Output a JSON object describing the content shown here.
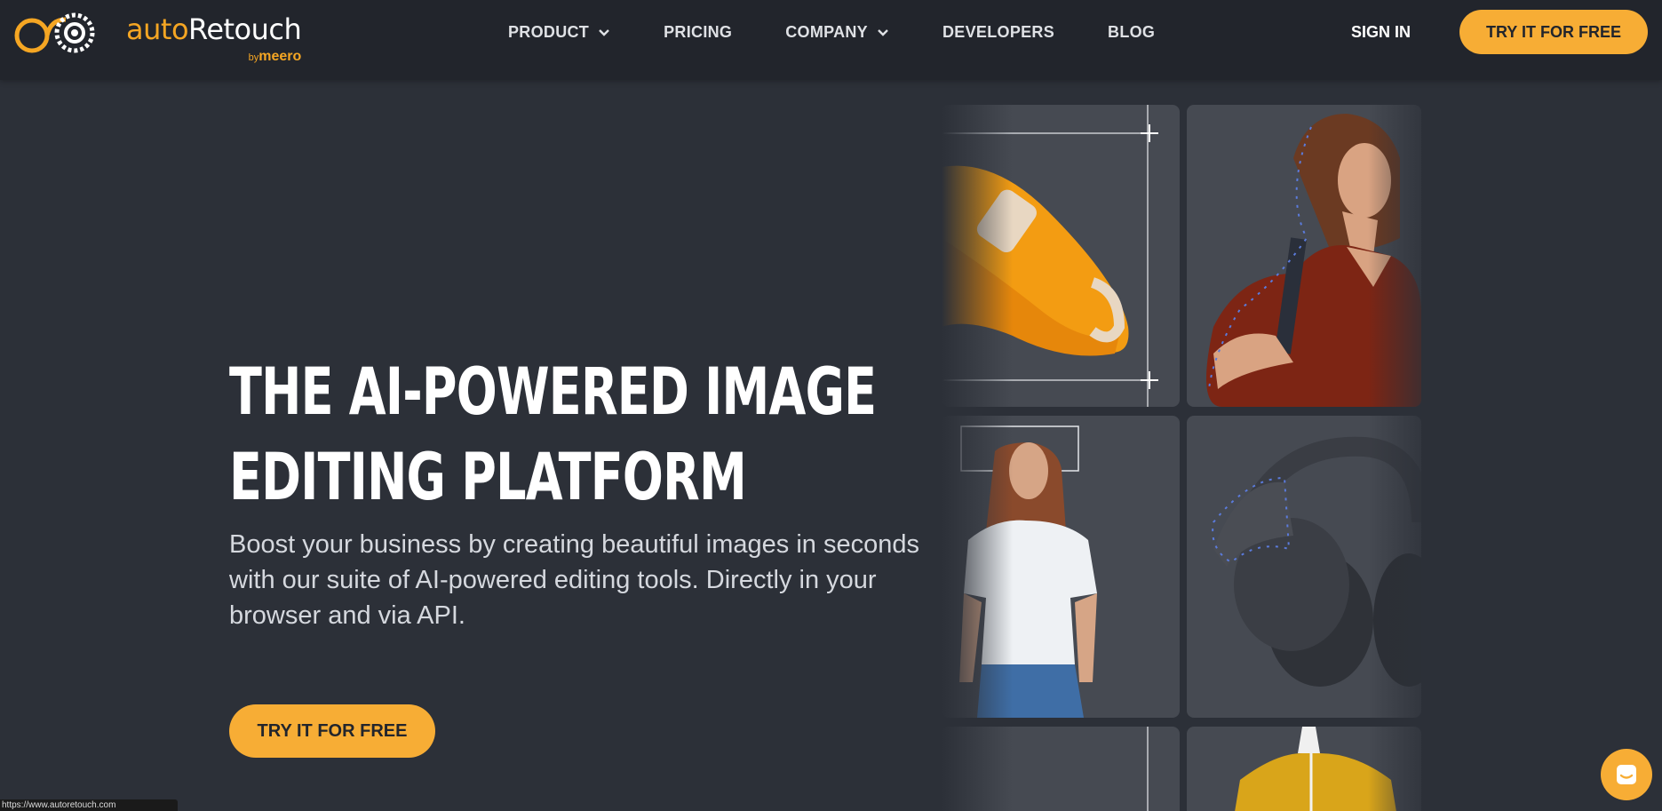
{
  "brand": {
    "name_part1": "auto",
    "name_part2": "Retouch",
    "by": "by",
    "parent": "meero",
    "accent": "#f5a623"
  },
  "nav": {
    "items": [
      {
        "label": "PRODUCT",
        "has_dropdown": true
      },
      {
        "label": "PRICING",
        "has_dropdown": false
      },
      {
        "label": "COMPANY",
        "has_dropdown": true
      },
      {
        "label": "DEVELOPERS",
        "has_dropdown": false
      },
      {
        "label": "BLOG",
        "has_dropdown": false
      }
    ],
    "sign_in": "SIGN IN",
    "cta": "TRY IT FOR FREE"
  },
  "hero": {
    "title_line1": "THE AI-POWERED IMAGE",
    "title_line2": "EDITING PLATFORM",
    "subtitle": "Boost your business by creating beautiful images in seconds with our suite of AI-powered editing tools. Directly in your browser and via API.",
    "cta": "TRY IT FOR FREE"
  },
  "gallery": {
    "tiles": [
      "sneaker-image",
      "woman-red-blouse-image",
      "woman-white-tshirt-image",
      "headphones-image",
      "partial-empty-image",
      "yellow-shirt-mannequin-image"
    ]
  },
  "status_bar": {
    "url": "https://www.autoretouch.com"
  },
  "chat": {
    "icon": "chat-icon"
  },
  "colors": {
    "background": "#2c3038",
    "nav": "#22252c",
    "cta": "#f7ad35",
    "tile": "#464a52"
  }
}
